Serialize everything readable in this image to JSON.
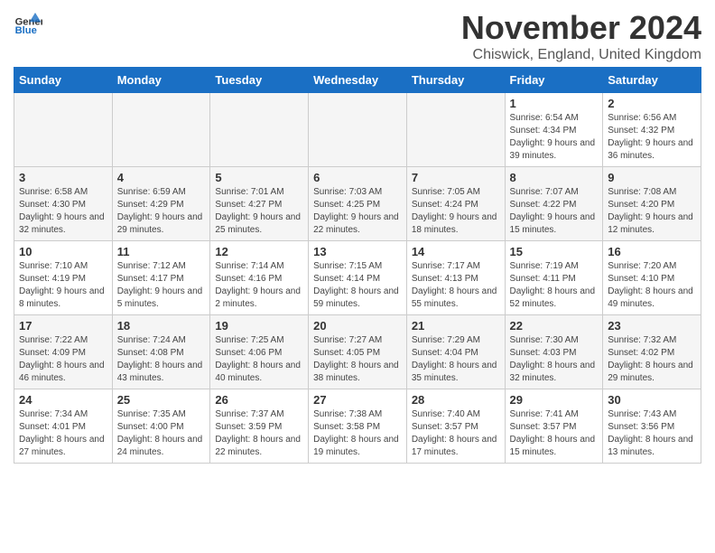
{
  "logo": {
    "general": "General",
    "blue": "Blue"
  },
  "header": {
    "month": "November 2024",
    "location": "Chiswick, England, United Kingdom"
  },
  "days_of_week": [
    "Sunday",
    "Monday",
    "Tuesday",
    "Wednesday",
    "Thursday",
    "Friday",
    "Saturday"
  ],
  "weeks": [
    [
      {
        "num": "",
        "info": ""
      },
      {
        "num": "",
        "info": ""
      },
      {
        "num": "",
        "info": ""
      },
      {
        "num": "",
        "info": ""
      },
      {
        "num": "",
        "info": ""
      },
      {
        "num": "1",
        "info": "Sunrise: 6:54 AM\nSunset: 4:34 PM\nDaylight: 9 hours and 39 minutes."
      },
      {
        "num": "2",
        "info": "Sunrise: 6:56 AM\nSunset: 4:32 PM\nDaylight: 9 hours and 36 minutes."
      }
    ],
    [
      {
        "num": "3",
        "info": "Sunrise: 6:58 AM\nSunset: 4:30 PM\nDaylight: 9 hours and 32 minutes."
      },
      {
        "num": "4",
        "info": "Sunrise: 6:59 AM\nSunset: 4:29 PM\nDaylight: 9 hours and 29 minutes."
      },
      {
        "num": "5",
        "info": "Sunrise: 7:01 AM\nSunset: 4:27 PM\nDaylight: 9 hours and 25 minutes."
      },
      {
        "num": "6",
        "info": "Sunrise: 7:03 AM\nSunset: 4:25 PM\nDaylight: 9 hours and 22 minutes."
      },
      {
        "num": "7",
        "info": "Sunrise: 7:05 AM\nSunset: 4:24 PM\nDaylight: 9 hours and 18 minutes."
      },
      {
        "num": "8",
        "info": "Sunrise: 7:07 AM\nSunset: 4:22 PM\nDaylight: 9 hours and 15 minutes."
      },
      {
        "num": "9",
        "info": "Sunrise: 7:08 AM\nSunset: 4:20 PM\nDaylight: 9 hours and 12 minutes."
      }
    ],
    [
      {
        "num": "10",
        "info": "Sunrise: 7:10 AM\nSunset: 4:19 PM\nDaylight: 9 hours and 8 minutes."
      },
      {
        "num": "11",
        "info": "Sunrise: 7:12 AM\nSunset: 4:17 PM\nDaylight: 9 hours and 5 minutes."
      },
      {
        "num": "12",
        "info": "Sunrise: 7:14 AM\nSunset: 4:16 PM\nDaylight: 9 hours and 2 minutes."
      },
      {
        "num": "13",
        "info": "Sunrise: 7:15 AM\nSunset: 4:14 PM\nDaylight: 8 hours and 59 minutes."
      },
      {
        "num": "14",
        "info": "Sunrise: 7:17 AM\nSunset: 4:13 PM\nDaylight: 8 hours and 55 minutes."
      },
      {
        "num": "15",
        "info": "Sunrise: 7:19 AM\nSunset: 4:11 PM\nDaylight: 8 hours and 52 minutes."
      },
      {
        "num": "16",
        "info": "Sunrise: 7:20 AM\nSunset: 4:10 PM\nDaylight: 8 hours and 49 minutes."
      }
    ],
    [
      {
        "num": "17",
        "info": "Sunrise: 7:22 AM\nSunset: 4:09 PM\nDaylight: 8 hours and 46 minutes."
      },
      {
        "num": "18",
        "info": "Sunrise: 7:24 AM\nSunset: 4:08 PM\nDaylight: 8 hours and 43 minutes."
      },
      {
        "num": "19",
        "info": "Sunrise: 7:25 AM\nSunset: 4:06 PM\nDaylight: 8 hours and 40 minutes."
      },
      {
        "num": "20",
        "info": "Sunrise: 7:27 AM\nSunset: 4:05 PM\nDaylight: 8 hours and 38 minutes."
      },
      {
        "num": "21",
        "info": "Sunrise: 7:29 AM\nSunset: 4:04 PM\nDaylight: 8 hours and 35 minutes."
      },
      {
        "num": "22",
        "info": "Sunrise: 7:30 AM\nSunset: 4:03 PM\nDaylight: 8 hours and 32 minutes."
      },
      {
        "num": "23",
        "info": "Sunrise: 7:32 AM\nSunset: 4:02 PM\nDaylight: 8 hours and 29 minutes."
      }
    ],
    [
      {
        "num": "24",
        "info": "Sunrise: 7:34 AM\nSunset: 4:01 PM\nDaylight: 8 hours and 27 minutes."
      },
      {
        "num": "25",
        "info": "Sunrise: 7:35 AM\nSunset: 4:00 PM\nDaylight: 8 hours and 24 minutes."
      },
      {
        "num": "26",
        "info": "Sunrise: 7:37 AM\nSunset: 3:59 PM\nDaylight: 8 hours and 22 minutes."
      },
      {
        "num": "27",
        "info": "Sunrise: 7:38 AM\nSunset: 3:58 PM\nDaylight: 8 hours and 19 minutes."
      },
      {
        "num": "28",
        "info": "Sunrise: 7:40 AM\nSunset: 3:57 PM\nDaylight: 8 hours and 17 minutes."
      },
      {
        "num": "29",
        "info": "Sunrise: 7:41 AM\nSunset: 3:57 PM\nDaylight: 8 hours and 15 minutes."
      },
      {
        "num": "30",
        "info": "Sunrise: 7:43 AM\nSunset: 3:56 PM\nDaylight: 8 hours and 13 minutes."
      }
    ]
  ]
}
